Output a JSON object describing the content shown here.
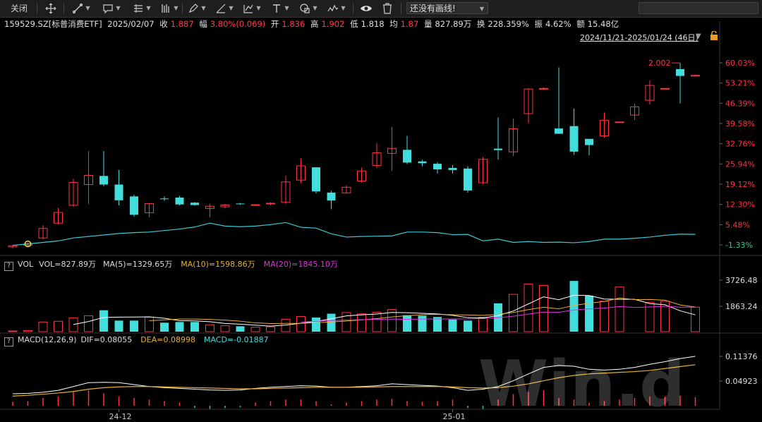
{
  "toolbar": {
    "close_label": "关闭",
    "line_style_select": "还没有画线!",
    "tools": [
      "move-icon",
      "line-icon",
      "comment-icon",
      "grid-icon",
      "bars-icon",
      "pen-icon",
      "angle-icon",
      "fork-icon",
      "text-icon",
      "shape-icon",
      "wave-icon",
      "eye-icon",
      "trash-icon"
    ]
  },
  "quote": {
    "code": "159529.SZ[标普消费ETF]",
    "date": "2025/02/07",
    "close_label": "收",
    "close": "1.887",
    "change_label": "幅",
    "change": "3.80%(0.069)",
    "open_label": "开",
    "open": "1.836",
    "high_label": "高",
    "high": "1.902",
    "low_label": "低",
    "low": "1.818",
    "avg_label": "均",
    "avg": "1.87",
    "volume_label": "量",
    "volume": "827.89万",
    "turnover_label": "换",
    "turnover": "228.359%",
    "amplitude_label": "振",
    "amplitude": "4.62%",
    "amount_label": "额",
    "amount": "15.48亿"
  },
  "range_label": "2024/11/21-2025/01/24 (46日)",
  "price_axis": [
    "60.03%",
    "53.21%",
    "46.39%",
    "39.58%",
    "32.76%",
    "25.94%",
    "19.12%",
    "12.30%",
    "5.48%",
    "-1.33%"
  ],
  "max_label": "2.002",
  "vol_pane": {
    "name": "VOL",
    "vol": "VOL=827.89万",
    "ma5": "MA(5)=1329.65万",
    "ma10": "MA(10)=1598.86万",
    "ma20": "MA(20)=1845.10万",
    "axis": [
      "3726.48",
      "1863.24"
    ]
  },
  "macd_pane": {
    "name": "MACD(12,26,9)",
    "dif": "DIF=0.08055",
    "dea": "DEA=0.08998",
    "macd": "MACD=-0.01887",
    "axis": [
      "0.11376",
      "0.04923"
    ]
  },
  "date_axis": [
    "24-12",
    "25-01"
  ],
  "watermark": "Win.d",
  "colors": {
    "up": "#ff3344",
    "down": "#44dddd",
    "ma5": "#ffffff",
    "ma10": "#e8b030",
    "ma20": "#e030e0",
    "dif": "#ffffff",
    "dea": "#e8b030",
    "macd_neg": "#33cc88"
  },
  "chart_data": {
    "type": "candlestick",
    "x": [
      "2024-11-21",
      "2024-11-22",
      "2024-11-25",
      "2024-11-26",
      "2024-11-27",
      "2024-11-28",
      "2024-11-29",
      "2024-12-02",
      "2024-12-03",
      "2024-12-04",
      "2024-12-05",
      "2024-12-06",
      "2024-12-09",
      "2024-12-10",
      "2024-12-11",
      "2024-12-12",
      "2024-12-13",
      "2024-12-16",
      "2024-12-17",
      "2024-12-18",
      "2024-12-19",
      "2024-12-20",
      "2024-12-23",
      "2024-12-24",
      "2024-12-25",
      "2024-12-26",
      "2024-12-27",
      "2024-12-30",
      "2024-12-31",
      "2025-01-02",
      "2025-01-03",
      "2025-01-06",
      "2025-01-07",
      "2025-01-08",
      "2025-01-09",
      "2025-01-10",
      "2025-01-13",
      "2025-01-14",
      "2025-01-15",
      "2025-01-16",
      "2025-01-17",
      "2025-01-20",
      "2025-01-21",
      "2025-01-22",
      "2025-01-23",
      "2025-01-24"
    ],
    "candles_pct": [
      {
        "o": -2,
        "h": -1.5,
        "l": -2.5,
        "c": -1.6,
        "up": true
      },
      {
        "o": -1.5,
        "h": -0.5,
        "l": -2,
        "c": -1,
        "up": true
      },
      {
        "o": 1,
        "h": 5.3,
        "l": 0.5,
        "c": 4.2,
        "up": true
      },
      {
        "o": 6,
        "h": 11.1,
        "l": 5.5,
        "c": 9.6,
        "up": true
      },
      {
        "o": 12,
        "h": 20.9,
        "l": 11.5,
        "c": 19.7,
        "up": true
      },
      {
        "o": 19,
        "h": 30.2,
        "l": 12.5,
        "c": 22.1,
        "up": true
      },
      {
        "o": 21.9,
        "h": 30.3,
        "l": 18.4,
        "c": 19,
        "up": false
      },
      {
        "o": 19,
        "h": 23.9,
        "l": 12,
        "c": 13.7,
        "up": false
      },
      {
        "o": 15,
        "h": 15.5,
        "l": 8.2,
        "c": 8.8,
        "up": false
      },
      {
        "o": 9.5,
        "h": 12.7,
        "l": 8,
        "c": 12.6,
        "up": true
      },
      {
        "o": 14.3,
        "h": 15,
        "l": 13.5,
        "c": 14.1,
        "up": false
      },
      {
        "o": 14.6,
        "h": 15.2,
        "l": 12,
        "c": 12.3,
        "up": false
      },
      {
        "o": 12.9,
        "h": 13.1,
        "l": 11.9,
        "c": 12.1,
        "up": false
      },
      {
        "o": 10.9,
        "h": 12.4,
        "l": 8,
        "c": 11.7,
        "up": true
      },
      {
        "o": 11.5,
        "h": 12.5,
        "l": 11,
        "c": 12.1,
        "up": true
      },
      {
        "o": 12.6,
        "h": 12.8,
        "l": 12.2,
        "c": 12.4,
        "up": false
      },
      {
        "o": 12,
        "h": 12.4,
        "l": 11.8,
        "c": 12.2,
        "up": true
      },
      {
        "o": 12.5,
        "h": 13,
        "l": 12,
        "c": 12.7,
        "up": true
      },
      {
        "o": 13,
        "h": 22,
        "l": 12.5,
        "c": 19.9,
        "up": true
      },
      {
        "o": 20.5,
        "h": 27.8,
        "l": 19.5,
        "c": 25.3,
        "up": true
      },
      {
        "o": 24.8,
        "h": 24.9,
        "l": 16,
        "c": 16.7,
        "up": false
      },
      {
        "o": 16.3,
        "h": 16.9,
        "l": 10.7,
        "c": 13.6,
        "up": false
      },
      {
        "o": 16.2,
        "h": 18.7,
        "l": 15.9,
        "c": 18.1,
        "up": true
      },
      {
        "o": 20.2,
        "h": 24.7,
        "l": 19.7,
        "c": 23.6,
        "up": true
      },
      {
        "o": 25.4,
        "h": 32.9,
        "l": 24.6,
        "c": 29.7,
        "up": true
      },
      {
        "o": 29.5,
        "h": 38.4,
        "l": 23.6,
        "c": 31.2,
        "up": true
      },
      {
        "o": 30.7,
        "h": 35.4,
        "l": 25.9,
        "c": 26.4,
        "up": false
      },
      {
        "o": 26.8,
        "h": 27.3,
        "l": 25.2,
        "c": 26.2,
        "up": false
      },
      {
        "o": 26,
        "h": 26.6,
        "l": 22.7,
        "c": 24.1,
        "up": false
      },
      {
        "o": 24.6,
        "h": 25.6,
        "l": 22.7,
        "c": 23.9,
        "up": false
      },
      {
        "o": 24.4,
        "h": 25.2,
        "l": 16.3,
        "c": 17,
        "up": false
      },
      {
        "o": 19.6,
        "h": 28.3,
        "l": 19.1,
        "c": 27.5,
        "up": true
      },
      {
        "o": 30.6,
        "h": 41.6,
        "l": 27.4,
        "c": 31.1,
        "up": false
      },
      {
        "o": 30,
        "h": 41.2,
        "l": 28.6,
        "c": 37.8,
        "up": true
      },
      {
        "o": 42.9,
        "h": 51.5,
        "l": 39.6,
        "c": 51.2,
        "up": true
      },
      {
        "o": 51.4,
        "h": 51.7,
        "l": 50.9,
        "c": 51.2,
        "up": true
      },
      {
        "o": 37.9,
        "h": 58.5,
        "l": 36.5,
        "c": 36.1,
        "up": false
      },
      {
        "o": 38.7,
        "h": 44.6,
        "l": 29,
        "c": 30.1,
        "up": false
      },
      {
        "o": 34.4,
        "h": 34.4,
        "l": 28.8,
        "c": 32.3,
        "up": false
      },
      {
        "o": 35.4,
        "h": 43.3,
        "l": 34.8,
        "c": 40.6,
        "up": true
      },
      {
        "o": 40.1,
        "h": 40.1,
        "l": 40,
        "c": 40.1,
        "up": true
      },
      {
        "o": 42.4,
        "h": 46.2,
        "l": 40.8,
        "c": 45.2,
        "up": true
      },
      {
        "o": 47.4,
        "h": 54.1,
        "l": 46,
        "c": 52.4,
        "up": true
      },
      {
        "o": 51.4,
        "h": 51.5,
        "l": 51.1,
        "c": 51.4,
        "up": true
      },
      {
        "o": 55.6,
        "h": 60,
        "l": 46.3,
        "c": 57.9,
        "up": false
      },
      {
        "o": 55.8,
        "h": 56,
        "l": 55.6,
        "c": 55.7,
        "up": true
      }
    ],
    "ma_line_pct": [
      -1.5,
      -1,
      -0.5,
      0,
      1,
      1.5,
      2,
      2.5,
      2.8,
      3,
      3.5,
      4,
      4.7,
      6,
      5,
      4.8,
      5,
      5.5,
      6.2,
      4.6,
      4.3,
      2.4,
      1.3,
      1.5,
      1.6,
      1.7,
      3,
      3,
      2.8,
      2.1,
      2.2,
      0,
      0.6,
      -0.5,
      -0.2,
      -0.5,
      -0.4,
      -0.6,
      -0.2,
      0.6,
      0.6,
      0.9,
      1.3,
      1.9,
      2.3,
      2.2
    ],
    "volume_wan": [
      50,
      80,
      700,
      750,
      1000,
      1150,
      1550,
      800,
      800,
      1050,
      650,
      700,
      700,
      500,
      430,
      390,
      330,
      350,
      900,
      1100,
      1020,
      1300,
      1380,
      1290,
      1400,
      1600,
      1190,
      1160,
      1060,
      880,
      800,
      1050,
      2050,
      2700,
      3450,
      3350,
      0,
      3670,
      2600,
      2200,
      3230,
      0,
      2110,
      2200,
      0,
      1770
    ],
    "macd_bars": [
      0.005,
      0.006,
      0.01,
      0.012,
      0.018,
      0.02,
      0.016,
      0.012,
      0.01,
      0.008,
      0.006,
      0.004,
      -0.003,
      -0.004,
      -0.003,
      -0.002,
      0.004,
      0.006,
      0.008,
      0.008,
      0.006,
      0.002,
      0.004,
      0.006,
      0.008,
      0.009,
      0.006,
      0.005,
      0.006,
      0.008,
      -0.003,
      -0.004,
      0.008,
      0.015,
      0.018,
      0.02,
      0.01,
      0.008,
      0.004,
      0.006,
      0.008,
      0.01,
      0.012,
      0.012,
      0.013,
      0.011
    ],
    "dif": [
      0.016,
      0.017,
      0.02,
      0.025,
      0.035,
      0.045,
      0.046,
      0.045,
      0.04,
      0.035,
      0.032,
      0.03,
      0.028,
      0.026,
      0.025,
      0.026,
      0.03,
      0.033,
      0.035,
      0.037,
      0.036,
      0.033,
      0.033,
      0.035,
      0.037,
      0.042,
      0.04,
      0.038,
      0.036,
      0.032,
      0.025,
      0.028,
      0.035,
      0.05,
      0.068,
      0.085,
      0.09,
      0.088,
      0.08,
      0.078,
      0.08,
      0.085,
      0.093,
      0.1,
      0.108,
      0.114
    ],
    "dea": [
      0.01,
      0.012,
      0.015,
      0.018,
      0.022,
      0.028,
      0.032,
      0.034,
      0.035,
      0.035,
      0.034,
      0.033,
      0.032,
      0.031,
      0.03,
      0.029,
      0.029,
      0.03,
      0.031,
      0.032,
      0.033,
      0.033,
      0.033,
      0.033,
      0.034,
      0.035,
      0.035,
      0.035,
      0.035,
      0.034,
      0.032,
      0.031,
      0.032,
      0.036,
      0.042,
      0.05,
      0.058,
      0.064,
      0.068,
      0.07,
      0.072,
      0.074,
      0.077,
      0.082,
      0.087,
      0.092
    ],
    "price_range_pct": [
      -1.33,
      60.03
    ]
  }
}
